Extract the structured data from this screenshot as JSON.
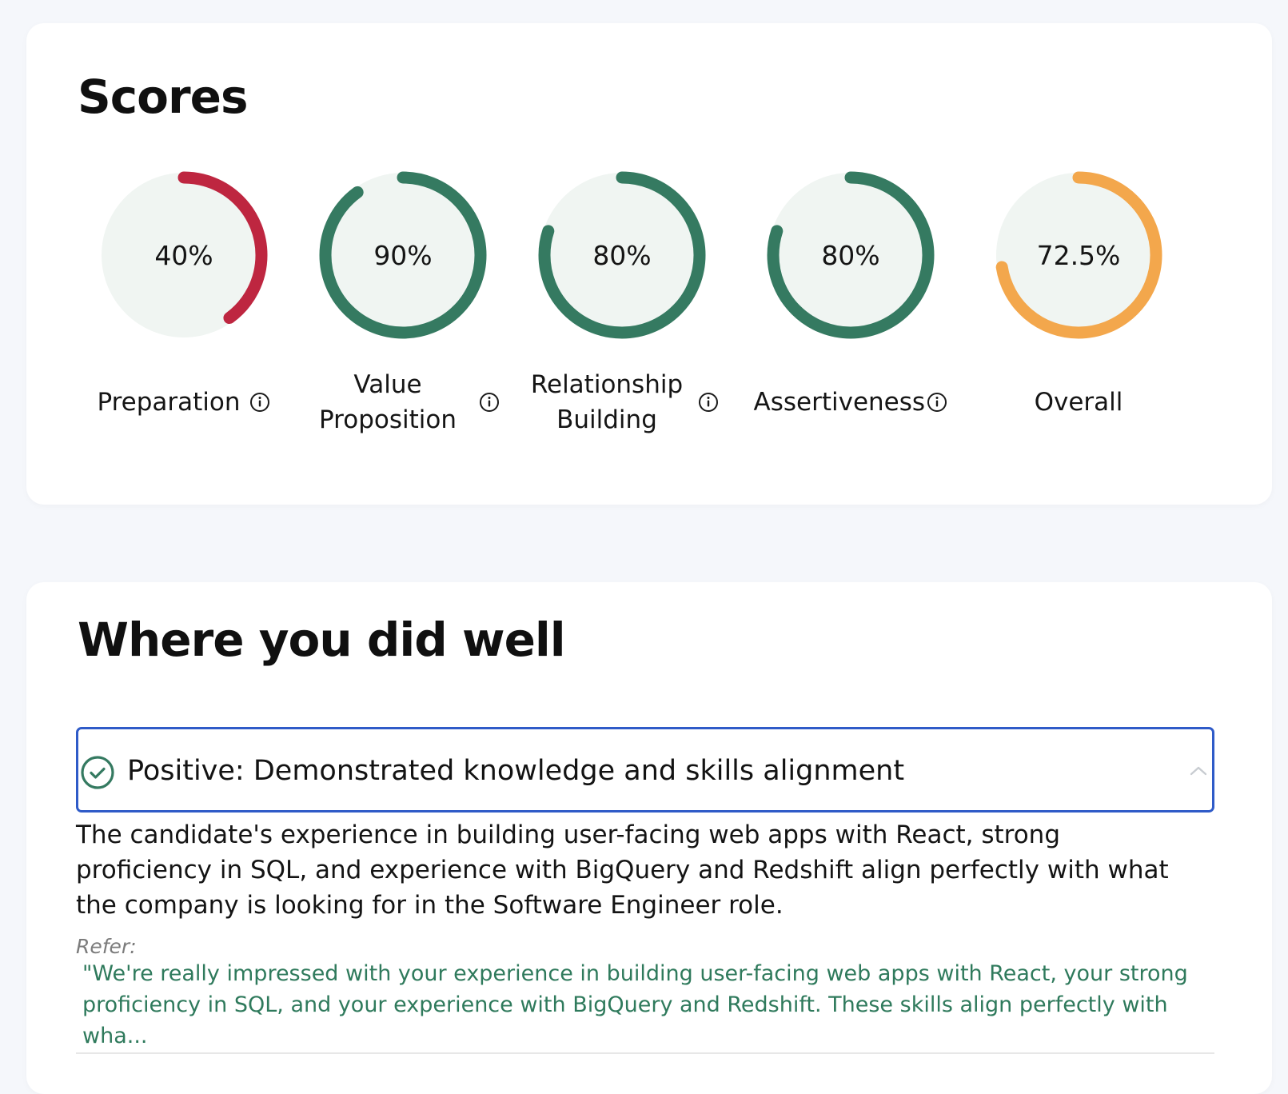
{
  "colors": {
    "gauge_track": "#f0f5f2",
    "preparation": "#be2640",
    "positive": "#357a61",
    "overall": "#f3a74c",
    "focus_border": "#2f5bc8",
    "quote_text": "#2f7a5c"
  },
  "scores_section": {
    "title": "Scores",
    "items": [
      {
        "key": "preparation",
        "label": "Preparation",
        "value_text": "40%",
        "progress": 0.4,
        "color_key": "preparation",
        "has_info": true
      },
      {
        "key": "value_proposition",
        "label": "Value Proposition",
        "value_text": "90%",
        "progress": 0.9,
        "color_key": "positive",
        "has_info": true
      },
      {
        "key": "relationship_building",
        "label": "Relationship Building",
        "value_text": "80%",
        "progress": 0.8,
        "color_key": "positive",
        "has_info": true
      },
      {
        "key": "assertiveness",
        "label": "Assertiveness",
        "value_text": "80%",
        "progress": 0.8,
        "color_key": "positive",
        "has_info": true
      },
      {
        "key": "overall",
        "label": "Overall",
        "value_text": "72.5%",
        "progress": 0.725,
        "color_key": "overall",
        "has_info": false
      }
    ]
  },
  "well_section": {
    "title": "Where you did well",
    "insight": {
      "icon": "check-circle-icon",
      "title": "Positive: Demonstrated knowledge and skills alignment",
      "expanded": true,
      "body": "The candidate's experience in building user-facing web apps with React, strong proficiency in SQL, and experience with BigQuery and Redshift align perfectly with what the company is looking for in the Software Engineer role.",
      "refer_label": "Refer:",
      "quote": "\"We're really impressed with your experience in building user-facing web apps with React, your strong proficiency in SQL, and your experience with BigQuery and Redshift. These skills align perfectly with wha..."
    }
  }
}
